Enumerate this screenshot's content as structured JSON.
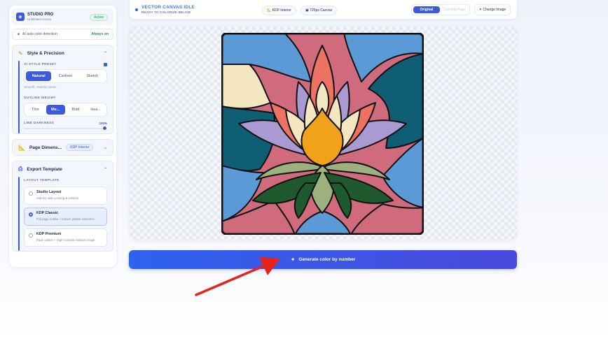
{
  "brand": {
    "title": "STUDIO PRO",
    "subtitle": "Unlimited Access",
    "status": "Active"
  },
  "detect": {
    "label": "AI auto color detection",
    "status": "Always on"
  },
  "style_panel": {
    "title": "Style & Precision",
    "preset_label": "AI STYLE PRESET",
    "presets": [
      "Natural",
      "Cartoon",
      "Sketch"
    ],
    "preset_selected": "Natural",
    "preset_hint": "Smooth, realistic zones",
    "outline_label": "OUTLINE WEIGHT",
    "outlines": [
      "Thin",
      "Me...",
      "Bold",
      "Hea..."
    ],
    "outline_selected": "Me...",
    "darkness_label": "LINE DARKNESS",
    "darkness_value": "100%",
    "darkness_level": 1.0
  },
  "dimensions_panel": {
    "title": "Page Dimens...",
    "chip": "KDP Interior"
  },
  "export_panel": {
    "title": "Export Template",
    "layout_label": "LAYOUT TEMPLATE",
    "templates": [
      {
        "name": "Studio Layout",
        "desc": "Side-by-side coloring & solution",
        "selected": false
      },
      {
        "name": "KDP Classic",
        "desc": "Full page outline + bottom palette swatches",
        "selected": true
      },
      {
        "name": "KDP Premium",
        "desc": "Page outline + High-contrast solution image",
        "selected": false
      }
    ]
  },
  "topbar": {
    "title": "VECTOR CANVAS IDLE",
    "subtitle": "READY TO COLORIZE BELOW",
    "chip_interior": "KDP Interior",
    "chip_canvas": "720px Canvas",
    "view_original": "Original",
    "view_coloring": "Coloring Page",
    "change_image": "Change Image"
  },
  "generate": {
    "label": "Generate color by number"
  },
  "colors": {
    "accent": "#3b5bdb",
    "success": "#1c9b5b",
    "art_blue": "#5b9ad6",
    "art_teal": "#0f5e73",
    "art_pink": "#d06b7e",
    "art_coral": "#ee7262",
    "art_lavender": "#a99ad3",
    "art_cream": "#f5e6c2",
    "art_orange": "#f2a21a",
    "art_sage": "#9db07d",
    "art_green": "#1f5a2e",
    "annotation": "#e8211b"
  },
  "icons": {
    "brand": "layers-icon",
    "detect": "sparkle-icon",
    "style": "pencil-icon",
    "dimensions": "ruler-icon",
    "export": "printer-icon",
    "generate": "sparkle-icon",
    "change": "close-icon"
  }
}
